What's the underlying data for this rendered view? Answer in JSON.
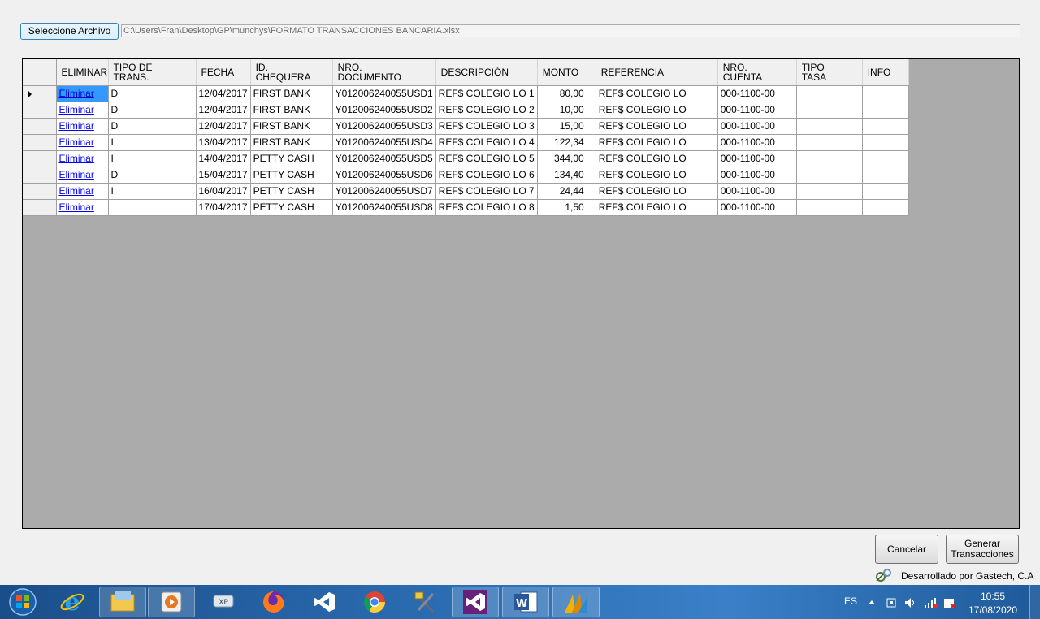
{
  "toolbar": {
    "select_file_label": "Seleccione Archivo",
    "file_path": "C:\\Users\\Fran\\Desktop\\GP\\munchys\\FORMATO TRANSACCIONES BANCARIA.xlsx"
  },
  "grid": {
    "columns": [
      "ELIMINAR",
      "TIPO DE\nTRANS.",
      "FECHA",
      "ID.\nCHEQUERA",
      "NRO.\nDOCUMENTO",
      "DESCRIPCIÓN",
      "MONTO",
      "REFERENCIA",
      "NRO.\nCUENTA",
      "TIPO\nTASA",
      "INFO"
    ],
    "rows": [
      {
        "eliminar": "Eliminar",
        "tipo": "D",
        "fecha": "12/04/2017",
        "chequera": "FIRST BANK",
        "documento": "Y012006240055USD1",
        "descripcion": "REF$ COLEGIO LO 1",
        "monto": "80,00",
        "referencia": "REF$ COLEGIO LO",
        "cuenta": "000-1100-00",
        "tasa": "",
        "info": ""
      },
      {
        "eliminar": "Eliminar",
        "tipo": "D",
        "fecha": "12/04/2017",
        "chequera": "FIRST BANK",
        "documento": "Y012006240055USD2",
        "descripcion": "REF$ COLEGIO LO 2",
        "monto": "10,00",
        "referencia": "REF$ COLEGIO LO",
        "cuenta": "000-1100-00",
        "tasa": "",
        "info": ""
      },
      {
        "eliminar": "Eliminar",
        "tipo": "D",
        "fecha": "12/04/2017",
        "chequera": "FIRST BANK",
        "documento": "Y012006240055USD3",
        "descripcion": "REF$ COLEGIO LO 3",
        "monto": "15,00",
        "referencia": "REF$ COLEGIO LO",
        "cuenta": "000-1100-00",
        "tasa": "",
        "info": ""
      },
      {
        "eliminar": "Eliminar",
        "tipo": "I",
        "fecha": "13/04/2017",
        "chequera": "FIRST BANK",
        "documento": "Y012006240055USD4",
        "descripcion": "REF$ COLEGIO LO 4",
        "monto": "122,34",
        "referencia": "REF$ COLEGIO LO",
        "cuenta": "000-1100-00",
        "tasa": "",
        "info": ""
      },
      {
        "eliminar": "Eliminar",
        "tipo": "I",
        "fecha": "14/04/2017",
        "chequera": "PETTY CASH",
        "documento": "Y012006240055USD5",
        "descripcion": "REF$ COLEGIO LO 5",
        "monto": "344,00",
        "referencia": "REF$ COLEGIO LO",
        "cuenta": "000-1100-00",
        "tasa": "",
        "info": ""
      },
      {
        "eliminar": "Eliminar",
        "tipo": "D",
        "fecha": "15/04/2017",
        "chequera": "PETTY CASH",
        "documento": "Y012006240055USD6",
        "descripcion": "REF$ COLEGIO LO 6",
        "monto": "134,40",
        "referencia": "REF$ COLEGIO LO",
        "cuenta": "000-1100-00",
        "tasa": "",
        "info": ""
      },
      {
        "eliminar": "Eliminar",
        "tipo": "I",
        "fecha": "16/04/2017",
        "chequera": "PETTY CASH",
        "documento": "Y012006240055USD7",
        "descripcion": "REF$ COLEGIO LO 7",
        "monto": "24,44",
        "referencia": "REF$ COLEGIO LO",
        "cuenta": "000-1100-00",
        "tasa": "",
        "info": ""
      },
      {
        "eliminar": "Eliminar",
        "tipo": "",
        "fecha": "17/04/2017",
        "chequera": "PETTY CASH",
        "documento": "Y012006240055USD8",
        "descripcion": "REF$ COLEGIO LO 8",
        "monto": "1,50",
        "referencia": "REF$ COLEGIO LO",
        "cuenta": "000-1100-00",
        "tasa": "",
        "info": ""
      }
    ]
  },
  "actions": {
    "cancel_label": "Cancelar",
    "generate_label": "Generar\nTransacciones"
  },
  "footer": {
    "credit": "Desarrollado por Gastech, C.A"
  },
  "taskbar": {
    "apps": [
      "start-icon",
      "internet-explorer-icon",
      "file-explorer-icon",
      "media-player-icon",
      "xp-mode-icon",
      "firefox-icon",
      "visual-studio-icon",
      "chrome-icon",
      "tools-icon",
      "visual-studio-active-icon",
      "word-icon",
      "dynamics-gp-icon"
    ],
    "language": "ES",
    "time": "10:55",
    "date": "17/08/2020"
  },
  "colors": {
    "grid_background": "#ababab",
    "selection": "#3399ff",
    "link": "#0000ff",
    "taskbar": "#2a6bb0"
  }
}
